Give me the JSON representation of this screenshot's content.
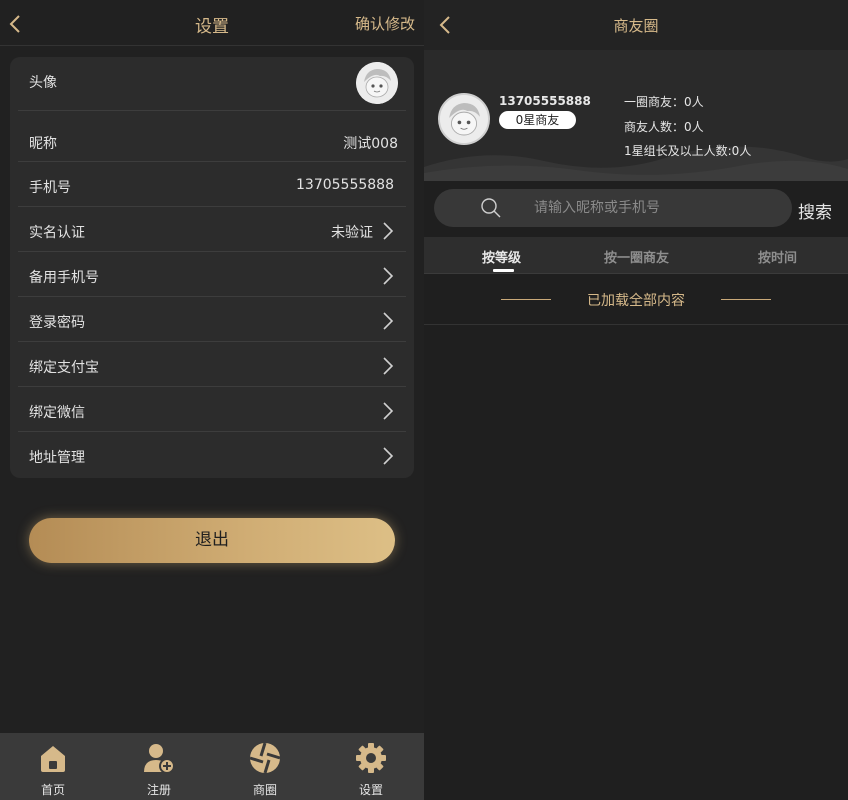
{
  "left": {
    "header": {
      "title": "设置",
      "confirm": "确认修改"
    },
    "rows": [
      {
        "label": "头像"
      },
      {
        "label": "昵称",
        "value": "测试008"
      },
      {
        "label": "手机号",
        "value": "13705555888"
      },
      {
        "label": "实名认证",
        "value": "未验证"
      },
      {
        "label": "备用手机号"
      },
      {
        "label": "登录密码"
      },
      {
        "label": "绑定支付宝"
      },
      {
        "label": "绑定微信"
      },
      {
        "label": "地址管理"
      }
    ],
    "logout": "退出",
    "tabs": [
      {
        "label": "首页",
        "icon": "home-icon"
      },
      {
        "label": "注册",
        "icon": "add-user-icon"
      },
      {
        "label": "商圈",
        "icon": "aperture-icon"
      },
      {
        "label": "设置",
        "icon": "gear-icon"
      }
    ]
  },
  "right": {
    "header": {
      "title": "商友圈"
    },
    "profile": {
      "phone": "13705555888",
      "level": "0星商友",
      "stats": [
        "一圈商友：0人",
        "商友人数：0人",
        "1星组长及以上人数:0人"
      ]
    },
    "search": {
      "placeholder": "请输入昵称或手机号",
      "button": "搜索"
    },
    "subtabs": [
      "按等级",
      "按一圈商友",
      "按时间"
    ],
    "status": "已加载全部内容"
  },
  "colors": {
    "accent": "#d6b98a",
    "background": "#1f1f1f",
    "card": "#2c2c2c",
    "tabbar": "#3a3a3a"
  }
}
